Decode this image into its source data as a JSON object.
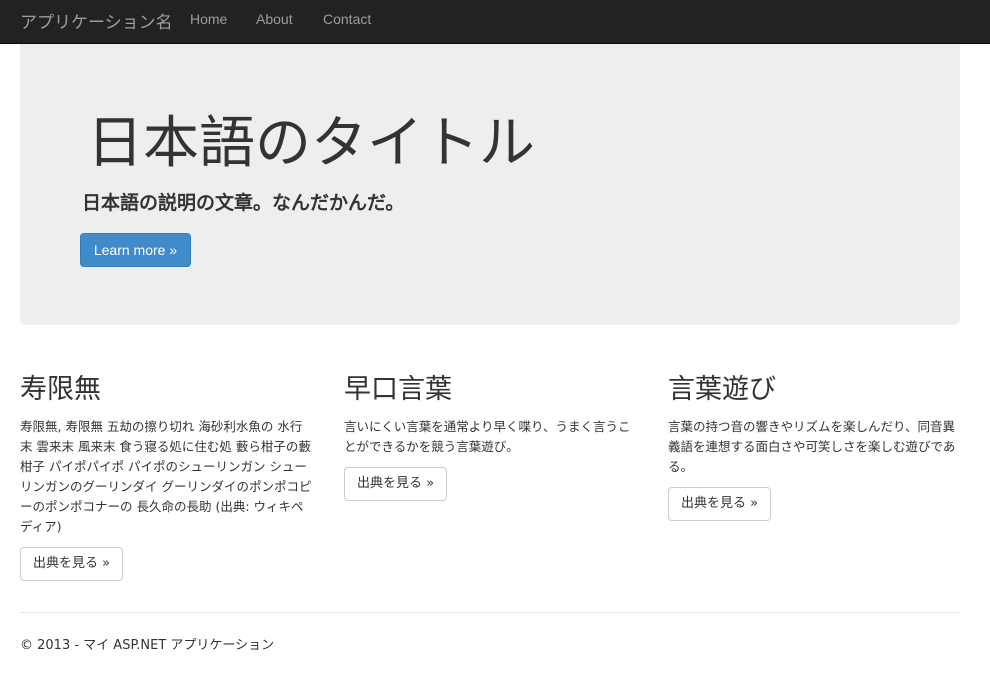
{
  "navbar": {
    "brand": "アプリケーション名",
    "links": [
      {
        "label": "Home"
      },
      {
        "label": "About"
      },
      {
        "label": "Contact"
      }
    ]
  },
  "jumbotron": {
    "title": "日本語のタイトル",
    "lead": "日本語の説明の文章。なんだかんだ。",
    "button_label": "Learn more »"
  },
  "columns": [
    {
      "heading": "寿限無",
      "body": "寿限無, 寿限無 五劫の擦り切れ 海砂利水魚の 水行末 雲来末 風来末 食う寝る処に住む処 藪ら柑子の藪柑子 パイポパイポ パイポのシューリンガン シューリンガンのグーリンダイ グーリンダイのポンポコピーのポンポコナーの 長久命の長助 (出典: ウィキペディア)",
      "button_label": "出典を見る »"
    },
    {
      "heading": "早口言葉",
      "body": "言いにくい言葉を通常より早く喋り、うまく言うことができるかを競う言葉遊び。",
      "button_label": "出典を見る »"
    },
    {
      "heading": "言葉遊び",
      "body": "言葉の持つ音の響きやリズムを楽しんだり、同音異義語を連想する面白さや可笑しさを楽しむ遊びである。",
      "button_label": "出典を見る »"
    }
  ],
  "footer": {
    "text": "© 2013 - マイ ASP.NET アプリケーション"
  },
  "colors": {
    "navbar_bg": "#222222",
    "nav_text": "#9d9d9d",
    "jumbotron_bg": "#eeeeee",
    "primary": "#428bca",
    "text": "#333333"
  }
}
